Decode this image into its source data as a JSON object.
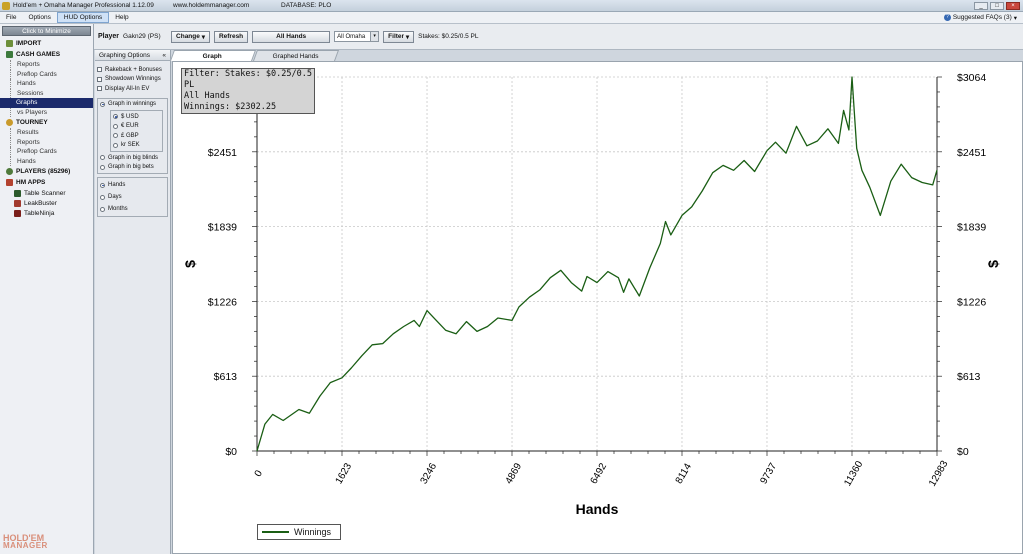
{
  "window": {
    "title": "Hold'em + Omaha Manager Professional 1.12.09",
    "url": "www.holdemmanager.com",
    "database": "DATABASE: PLO",
    "minimize_glyph": "_",
    "maximize_glyph": "□",
    "close_glyph": "×"
  },
  "menu": {
    "items": [
      "File",
      "Options",
      "HUD Options",
      "Help"
    ],
    "faq_label": "Suggested FAQs (3)",
    "faq_caret": "▾",
    "faq_icon_glyph": "?"
  },
  "sidebar": {
    "minimize_label": "Click to Minimize",
    "import_label": "IMPORT",
    "cash_label": "CASH GAMES",
    "cash_items": [
      "Reports",
      "Preflop Cards",
      "Hands",
      "Sessions",
      "Graphs",
      "vs Players"
    ],
    "tourney_label": "TOURNEY",
    "tourney_items": [
      "Results",
      "Reports",
      "Preflop Cards",
      "Hands"
    ],
    "players_label": "PLAYERS (85296)",
    "apps_label": "HM APPS",
    "apps": [
      "Table Scanner",
      "LeakBuster",
      "TableNinja"
    ],
    "logo_line1": "HOLD'EM",
    "logo_line2": "MANAGER"
  },
  "playerbar": {
    "label": "Player",
    "player_name": "Gakn29 (PS)",
    "change_label": "Change",
    "refresh_label": "Refresh",
    "all_hands_label": "All Hands",
    "game_select": "All Omaha",
    "filter_label": "Filter",
    "stakes_text": "Stakes: $0.25/0.5 PL",
    "dropdown_arrow": "▾"
  },
  "graph_options": {
    "header": "Graphing Options",
    "collapse_glyph": "«",
    "checkboxes": [
      "Rakeback + Bonuses",
      "Showdown Winnings",
      "Display All-In EV"
    ],
    "graph_in_winnings": "Graph in winnings",
    "currencies": [
      "$ USD",
      "€ EUR",
      "£ GBP",
      "kr SEK"
    ],
    "big_blinds": "Graph in big blinds",
    "big_bets": "Graph in big bets",
    "x_axis_options": [
      "Hands",
      "Days",
      "Months"
    ]
  },
  "tabs": [
    "Graph",
    "Graphed Hands"
  ],
  "filter_box": {
    "line1": "Filter: Stakes: $0.25/0.5 PL",
    "line2": "All Hands",
    "line3": "Winnings: $2302.25"
  },
  "colors": {
    "series": "#1a5e14",
    "selected_nav": "#1b2a6b"
  },
  "chart_data": {
    "type": "line",
    "xlabel": "Hands",
    "ylabel": "$",
    "xlim": [
      0,
      12983
    ],
    "ylim": [
      0,
      3064
    ],
    "x_ticks": [
      0,
      1623,
      3246,
      4869,
      6492,
      8114,
      9737,
      11360,
      12983
    ],
    "y_ticks": [
      "$0",
      "$613",
      "$1226",
      "$1839",
      "$2451",
      "$3064"
    ],
    "y_tick_values": [
      0,
      613,
      1226,
      1839,
      2451,
      3064
    ],
    "grid": true,
    "legend": "bottom-left",
    "series": [
      {
        "name": "Winnings",
        "x": [
          0,
          150,
          300,
          500,
          800,
          1000,
          1200,
          1400,
          1623,
          1800,
          2000,
          2200,
          2400,
          2600,
          2800,
          3000,
          3100,
          3246,
          3400,
          3600,
          3800,
          4000,
          4200,
          4400,
          4600,
          4869,
          5000,
          5200,
          5400,
          5600,
          5800,
          6000,
          6200,
          6300,
          6492,
          6700,
          6900,
          7000,
          7100,
          7300,
          7500,
          7700,
          7800,
          7900,
          8114,
          8300,
          8500,
          8700,
          8900,
          9100,
          9300,
          9500,
          9737,
          9900,
          10100,
          10300,
          10500,
          10700,
          10900,
          11100,
          11200,
          11300,
          11360,
          11450,
          11550,
          11700,
          11900,
          12100,
          12300,
          12500,
          12700,
          12900,
          12983
        ],
        "values": [
          0,
          220,
          300,
          250,
          340,
          310,
          450,
          560,
          600,
          680,
          780,
          870,
          880,
          960,
          1020,
          1070,
          1020,
          1150,
          1080,
          990,
          960,
          1060,
          980,
          1020,
          1090,
          1070,
          1180,
          1260,
          1320,
          1420,
          1480,
          1380,
          1310,
          1430,
          1380,
          1470,
          1420,
          1300,
          1410,
          1270,
          1500,
          1700,
          1880,
          1770,
          1930,
          2000,
          2130,
          2280,
          2340,
          2300,
          2380,
          2290,
          2460,
          2530,
          2440,
          2660,
          2500,
          2540,
          2640,
          2520,
          2790,
          2630,
          3064,
          2480,
          2300,
          2160,
          1930,
          2210,
          2350,
          2240,
          2200,
          2180,
          2302
        ]
      }
    ]
  }
}
